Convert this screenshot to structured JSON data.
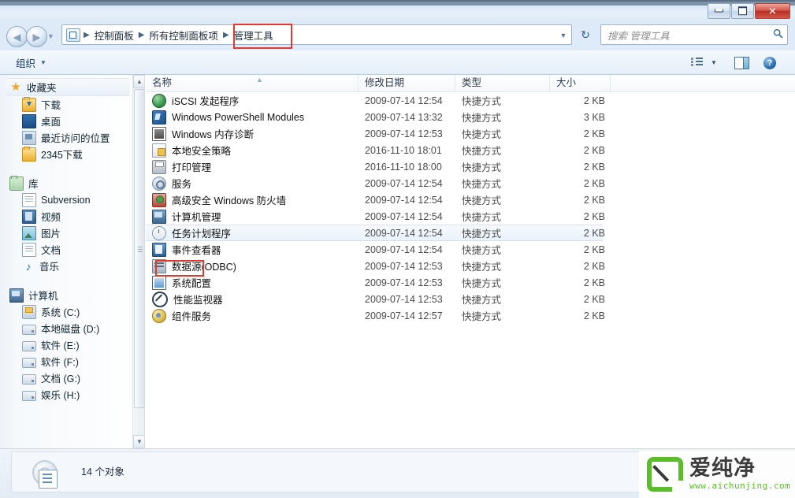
{
  "window": {
    "buttons": {
      "minimize": "minimize",
      "maximize": "maximize",
      "close": "✕"
    }
  },
  "address": {
    "breadcrumbs": [
      {
        "label": "控制面板"
      },
      {
        "label": "所有控制面板项"
      },
      {
        "label": "管理工具"
      }
    ],
    "separator": "▶",
    "dropdown_caret": "▼",
    "refresh_icon": "↻"
  },
  "search": {
    "placeholder": "搜索 管理工具",
    "icon": "search-icon"
  },
  "toolbar": {
    "organize_label": "组织",
    "organize_caret": "▼",
    "view_caret": "▼",
    "help_glyph": "?"
  },
  "sidebar": {
    "scroll_up": "▲",
    "scroll_down": "▼",
    "groups": [
      {
        "root": {
          "label": "收藏夹",
          "icon": "star-icon",
          "selected": true
        },
        "items": [
          {
            "label": "下载",
            "icon": "folder-download-icon"
          },
          {
            "label": "桌面",
            "icon": "desktop-icon"
          },
          {
            "label": "最近访问的位置",
            "icon": "recent-places-icon"
          },
          {
            "label": "2345下载",
            "icon": "folder-icon"
          }
        ]
      },
      {
        "root": {
          "label": "库",
          "icon": "library-icon",
          "selected": false
        },
        "items": [
          {
            "label": "Subversion",
            "icon": "document-icon"
          },
          {
            "label": "视频",
            "icon": "video-icon"
          },
          {
            "label": "图片",
            "icon": "picture-icon"
          },
          {
            "label": "文档",
            "icon": "document-icon"
          },
          {
            "label": "音乐",
            "icon": "music-icon"
          }
        ]
      },
      {
        "root": {
          "label": "计算机",
          "icon": "computer-icon",
          "selected": false
        },
        "items": [
          {
            "label": "系统 (C:)",
            "icon": "system-drive-icon"
          },
          {
            "label": "本地磁盘 (D:)",
            "icon": "drive-icon"
          },
          {
            "label": "软件 (E:)",
            "icon": "drive-icon"
          },
          {
            "label": "软件 (F:)",
            "icon": "drive-icon"
          },
          {
            "label": "文档 (G:)",
            "icon": "drive-icon"
          },
          {
            "label": "娱乐 (H:)",
            "icon": "drive-icon"
          }
        ]
      }
    ]
  },
  "filelist": {
    "columns": [
      {
        "key": "name",
        "label": "名称",
        "sorted": true,
        "sort_arrow": "▲"
      },
      {
        "key": "date",
        "label": "修改日期"
      },
      {
        "key": "type",
        "label": "类型"
      },
      {
        "key": "size",
        "label": "大小"
      }
    ],
    "rows": [
      {
        "name": "iSCSI 发起程序",
        "date": "2009-07-14 12:54",
        "type": "快捷方式",
        "size": "2 KB",
        "icon": "iscsi-icon"
      },
      {
        "name": "Windows PowerShell Modules",
        "date": "2009-07-14 13:32",
        "type": "快捷方式",
        "size": "3 KB",
        "icon": "powershell-icon"
      },
      {
        "name": "Windows 内存诊断",
        "date": "2009-07-14 12:53",
        "type": "快捷方式",
        "size": "2 KB",
        "icon": "memory-diagnostic-icon"
      },
      {
        "name": "本地安全策略",
        "date": "2016-11-10 18:01",
        "type": "快捷方式",
        "size": "2 KB",
        "icon": "local-security-policy-icon"
      },
      {
        "name": "打印管理",
        "date": "2016-11-10 18:00",
        "type": "快捷方式",
        "size": "2 KB",
        "icon": "print-management-icon"
      },
      {
        "name": "服务",
        "date": "2009-07-14 12:54",
        "type": "快捷方式",
        "size": "2 KB",
        "icon": "services-icon",
        "highlighted": true
      },
      {
        "name": "高级安全 Windows 防火墙",
        "date": "2009-07-14 12:54",
        "type": "快捷方式",
        "size": "2 KB",
        "icon": "firewall-icon"
      },
      {
        "name": "计算机管理",
        "date": "2009-07-14 12:54",
        "type": "快捷方式",
        "size": "2 KB",
        "icon": "computer-management-icon"
      },
      {
        "name": "任务计划程序",
        "date": "2009-07-14 12:54",
        "type": "快捷方式",
        "size": "2 KB",
        "icon": "task-scheduler-icon",
        "hover": true
      },
      {
        "name": "事件查看器",
        "date": "2009-07-14 12:54",
        "type": "快捷方式",
        "size": "2 KB",
        "icon": "event-viewer-icon"
      },
      {
        "name": "数据源(ODBC)",
        "date": "2009-07-14 12:53",
        "type": "快捷方式",
        "size": "2 KB",
        "icon": "odbc-icon"
      },
      {
        "name": "系统配置",
        "date": "2009-07-14 12:53",
        "type": "快捷方式",
        "size": "2 KB",
        "icon": "system-config-icon"
      },
      {
        "name": "性能监视器",
        "date": "2009-07-14 12:53",
        "type": "快捷方式",
        "size": "2 KB",
        "icon": "performance-monitor-icon"
      },
      {
        "name": "组件服务",
        "date": "2009-07-14 12:57",
        "type": "快捷方式",
        "size": "2 KB",
        "icon": "component-services-icon"
      }
    ]
  },
  "statusbar": {
    "text": "14 个对象"
  },
  "watermark": {
    "title": "爱纯净",
    "url": "www.aichunjing.com"
  },
  "annotations": {
    "accent_color": "#e03a30",
    "boxes": [
      "breadcrumb-管理工具",
      "row-服务"
    ]
  }
}
